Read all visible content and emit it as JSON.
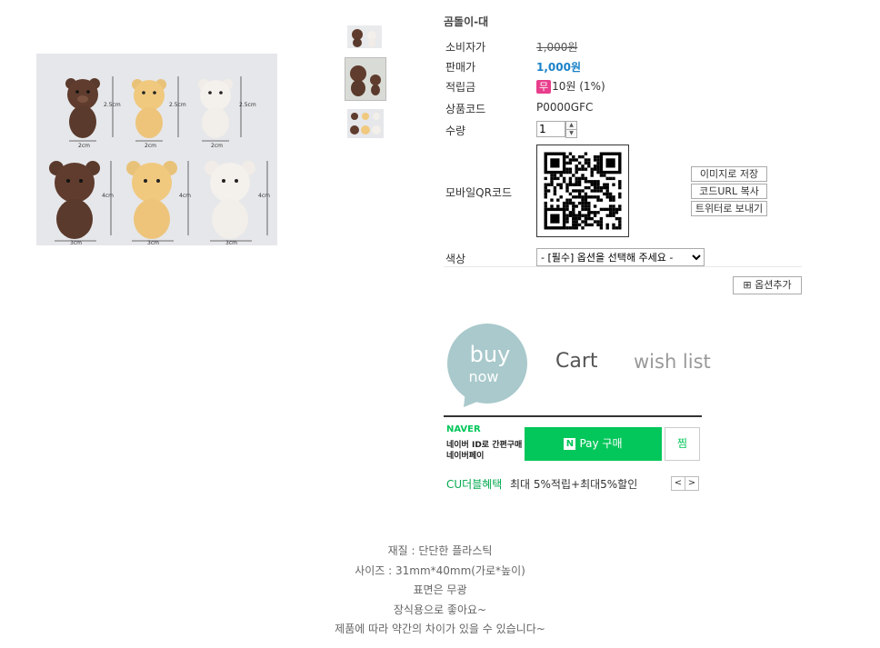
{
  "product": {
    "title": "곰돌이-대"
  },
  "info_rows": [
    {
      "label": "소비자가",
      "value": "1,000원"
    },
    {
      "label": "판매가",
      "value": "1,000원"
    },
    {
      "label": "적립금",
      "badge": "무",
      "value": "10원 (1%)"
    },
    {
      "label": "상품코드",
      "value": "P0000GFC"
    },
    {
      "label": "수량",
      "value": "1"
    },
    {
      "label": "모바일QR코드"
    },
    {
      "label": "색상"
    }
  ],
  "qr_buttons": [
    "이미지로 저장",
    "코드URL 복사",
    "트위터로 보내기"
  ],
  "color_select": {
    "selected": "- [필수] 옵션을 선택해 주세요 -"
  },
  "add_option_label": "옵션추가",
  "actions": {
    "buy_line1": "buy",
    "buy_line2": "now",
    "cart": "Cart",
    "wish": "wish list"
  },
  "naver": {
    "logo": "NAVER",
    "desc_line1": "네이버 ID로 간편구매",
    "desc_line2": "네이버페이",
    "pay_n": "N",
    "pay_label": "Pay 구매",
    "zzim": "찜"
  },
  "cu": {
    "title": "CU더블혜택",
    "text": "최대 5%적립+최대5%할인",
    "prev": "<",
    "next": ">"
  },
  "image_labels": {
    "width_small": "2cm",
    "height_small": "2.5cm",
    "width_big": "3cm",
    "height_big": "4cm"
  },
  "description": [
    "재질 : 단단한 플라스틱",
    "사이즈 : 31mm*40mm(가로*높이)",
    "표면은 무광",
    "장식용으로 좋아요~",
    "제품에 따라 약간의 차이가 있을 수 있습니다~"
  ],
  "colors": {
    "price_blue": "#1a82c8",
    "naver_green": "#03c75a",
    "bubble_teal": "#a9c9cc",
    "badge_pink": "#e83e8c"
  }
}
